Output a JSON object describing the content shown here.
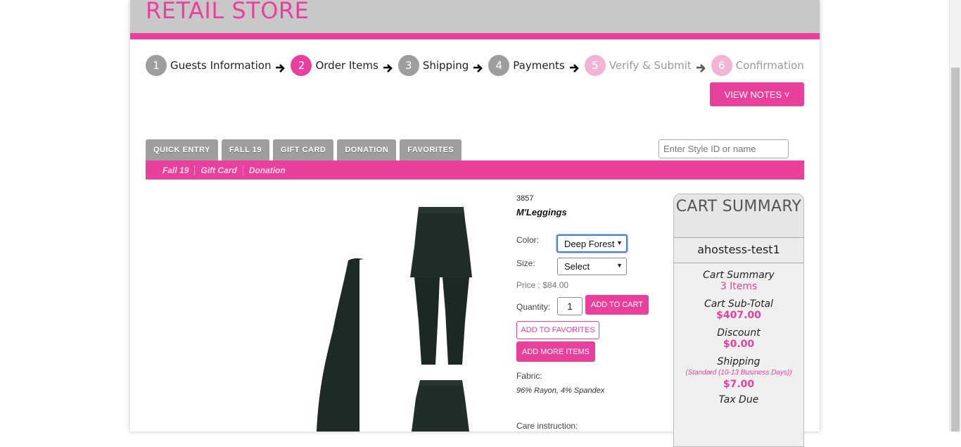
{
  "header": {
    "title": "RETAIL STORE"
  },
  "steps": [
    {
      "num": "1",
      "label": "Guests Information"
    },
    {
      "num": "2",
      "label": "Order Items"
    },
    {
      "num": "3",
      "label": "Shipping"
    },
    {
      "num": "4",
      "label": "Payments"
    },
    {
      "num": "5",
      "label": "Verify & Submit"
    },
    {
      "num": "6",
      "label": "Confirmation"
    }
  ],
  "view_notes_label": "VIEW NOTES ˅",
  "tabs": [
    "QUICK ENTRY",
    "FALL 19",
    "GIFT CARD",
    "DONATION",
    "FAVORITES"
  ],
  "search": {
    "placeholder": "Enter Style ID or name"
  },
  "subnav": [
    "Fall 19",
    "Gift Card",
    "Donation"
  ],
  "product": {
    "id": "3857",
    "name": "M'Leggings",
    "color_label": "Color:",
    "color_value": "Deep Forest",
    "size_label": "Size:",
    "size_value": "Select",
    "price": "Price : $84.00",
    "quantity_label": "Quantity:",
    "quantity_value": "1",
    "add_to_cart": "ADD TO CART",
    "add_to_favorites": "ADD TO FAVORITES",
    "add_more_items": "ADD MORE ITEMS",
    "fabric_label": "Fabric:",
    "fabric_value": "96% Rayon, 4% Spandex",
    "care_label": "Care instruction:"
  },
  "cart": {
    "title": "CART SUMMARY",
    "user": "ahostess-test1",
    "summary_label": "Cart Summary",
    "summary_value": "3 Items",
    "subtotal_label": "Cart Sub-Total",
    "subtotal_value": "$407.00",
    "discount_label": "Discount",
    "discount_value": "$0.00",
    "shipping_label": "Shipping",
    "shipping_method": "(Standard (10-13 Business Days))",
    "shipping_value": "$7.00",
    "tax_label": "Tax Due"
  },
  "colors": {
    "accent": "#e8409c",
    "step_gray": "#9e9e9e",
    "step_future": "#f2b4d4",
    "header_gray": "#c8c8c9"
  }
}
